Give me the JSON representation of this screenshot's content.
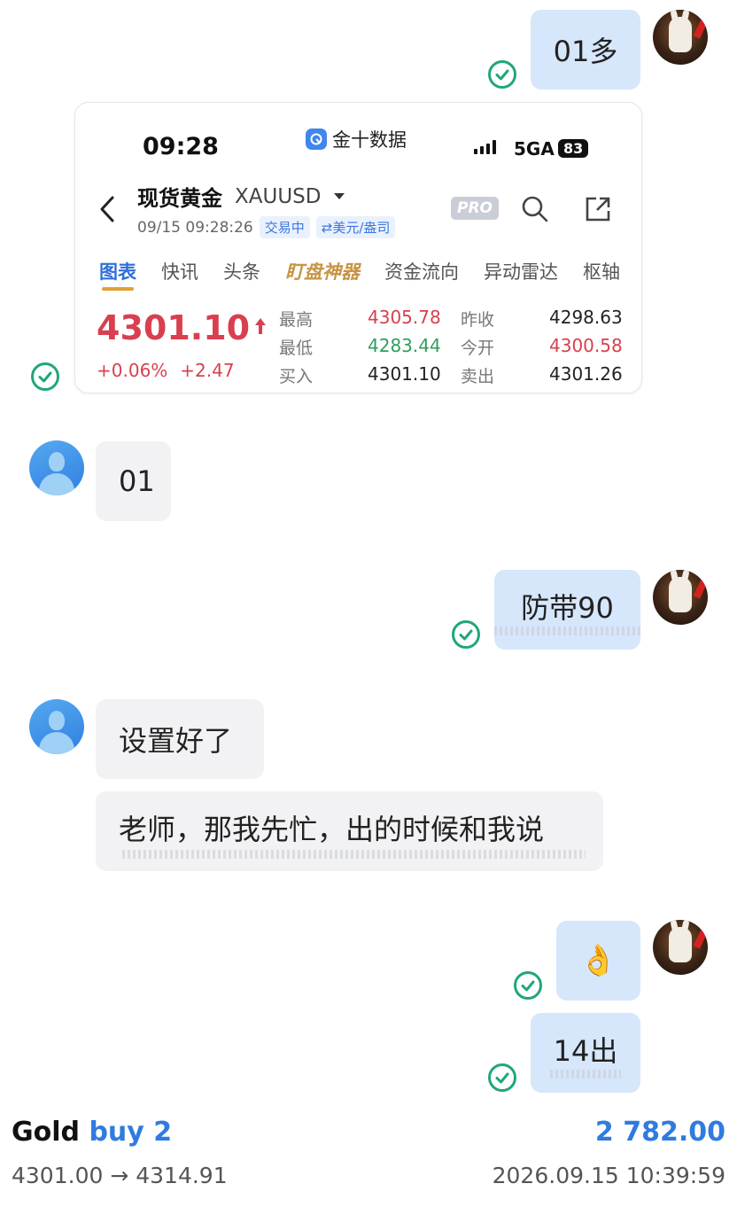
{
  "messages": {
    "m1": {
      "text": "01多"
    },
    "m3": {
      "text": "01"
    },
    "m4": {
      "text": "防带90"
    },
    "m5": {
      "text": "设置好了"
    },
    "m6": {
      "text": "老师，那我先忙，出的时候和我说"
    },
    "m7": {
      "text": "👌"
    },
    "m8": {
      "text": "14出"
    }
  },
  "card": {
    "status_time": "09:28",
    "app_name": "金十数据",
    "network": "5GA",
    "battery": "83",
    "instrument_name": "现货黄金",
    "instrument_code": "XAUUSD",
    "datetime": "09/15 09:28:26",
    "tag_trading": "交易中",
    "tag_unit": "⇄美元/盎司",
    "pro_label": "PRO",
    "tabs": [
      "图表",
      "快讯",
      "头条",
      "盯盘神器",
      "资金流向",
      "异动雷达",
      "枢轴"
    ],
    "price": "4301.10",
    "change_pct": "+0.06%",
    "change_abs": "+2.47",
    "quotes": [
      {
        "label": "最高",
        "value": "4305.78",
        "color": "#d9404f",
        "label2": "昨收",
        "value2": "4298.63",
        "color2": "#222222"
      },
      {
        "label": "最低",
        "value": "4283.44",
        "color": "#2e9e5e",
        "label2": "今开",
        "value2": "4300.58",
        "color2": "#d9404f"
      },
      {
        "label": "买入",
        "value": "4301.10",
        "color": "#222222",
        "label2": "卖出",
        "value2": "4301.26",
        "color2": "#222222"
      }
    ]
  },
  "footer": {
    "asset": "Gold",
    "action": "buy 2",
    "amount": "2 782.00",
    "price_range": "4301.00 → 4314.91",
    "timestamp": "2026.09.15 10:39:59"
  },
  "colors": {
    "accent": "#2f7be0",
    "outgoing_bubble": "#d6e6fb",
    "incoming_bubble": "#f2f2f4",
    "check": "#20a67a",
    "price_up": "#d9404f",
    "price_down": "#2e9e5e"
  }
}
